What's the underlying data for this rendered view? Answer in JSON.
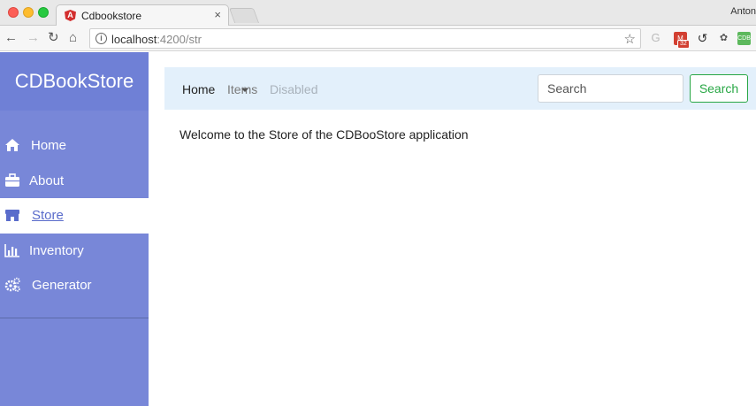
{
  "browser": {
    "tab_title": "Cdbookstore",
    "tab_close": "×",
    "favicon_letter": "A",
    "user": "Anton",
    "url_host": "localhost",
    "url_path": ":4200/str",
    "ext_badge": "32",
    "ext_cdb": "CDB"
  },
  "sidebar": {
    "brand": "CDBookStore",
    "items": [
      {
        "label": "Home",
        "icon": "home-icon"
      },
      {
        "label": "About",
        "icon": "briefcase-icon"
      },
      {
        "label": "Store",
        "icon": "store-icon",
        "active": true
      },
      {
        "label": "Inventory",
        "icon": "bar-chart-icon"
      },
      {
        "label": "Generator",
        "icon": "gears-icon"
      }
    ]
  },
  "navbar": {
    "home": "Home",
    "items": "Items",
    "disabled": "Disabled",
    "search_placeholder": "Search",
    "search_button": "Search"
  },
  "main": {
    "welcome": "Welcome to the Store of the CDBooStore application"
  },
  "colors": {
    "sidebar": "#7887d8",
    "navbar": "#e3f0fb",
    "search_button": "#28a745"
  }
}
